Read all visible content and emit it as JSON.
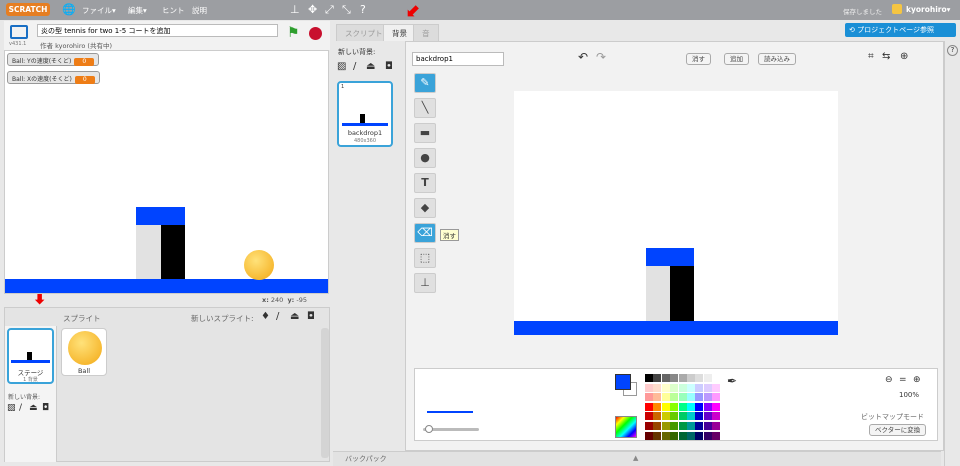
{
  "menubar": {
    "logo": "SCRATCH",
    "menus": [
      "ファイル▾",
      "編集▾",
      "ヒント",
      "説明"
    ],
    "status": "保存しました",
    "user": "kyorohiro▾"
  },
  "stagehead": {
    "title_value": "炎の型 tennis for two 1-5 コートを追加",
    "author": "作者 kyorohiro (共有中)",
    "version": "v431.1"
  },
  "monitors": [
    {
      "label": "Ball: Yの速度(そくど)",
      "value": "0"
    },
    {
      "label": "Ball: Xの速度(そくど)",
      "value": "0"
    }
  ],
  "coords": {
    "x_label": "x:",
    "x": "240",
    "y_label": "y:",
    "y": "-95"
  },
  "sprites": {
    "header": "スプライト",
    "new_sprite": "新しいスプライト:",
    "stage_label": "ステージ",
    "stage_sub": "1 背景",
    "new_backdrop": "新しい背景:",
    "items": [
      {
        "name": "Ball"
      }
    ]
  },
  "tabs": [
    "スクリプト",
    "背景",
    "音"
  ],
  "see_project": "プロジェクトページ参照",
  "backdrops": {
    "new_label": "新しい背景:",
    "items": [
      {
        "index": "1",
        "name": "backdrop1",
        "size": "480x360"
      }
    ]
  },
  "editor": {
    "name_value": "backdrop1",
    "clear": "消す",
    "add": "追加",
    "import": "読み込み",
    "tooltip": "消す",
    "zoom": "100%",
    "mode": "ビットマップモード",
    "convert": "ベクターに変換"
  },
  "colors": {
    "primary": "#0044ff",
    "secondary": "#ffffff",
    "court_blue": "#0044ff"
  },
  "backpack": "バックパック"
}
